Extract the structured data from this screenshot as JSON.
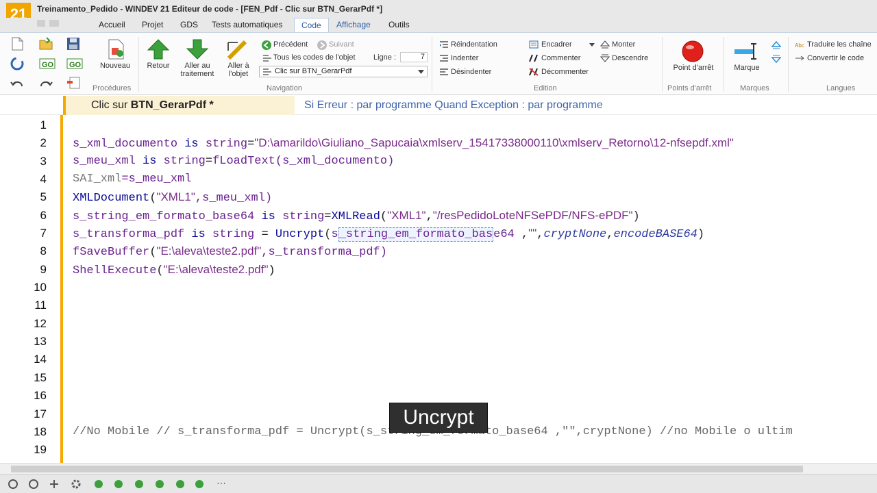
{
  "window": {
    "logo_text": "21",
    "title": "Treinamento_Pedido - WINDEV 21  Editeur de code - [FEN_Pdf - Clic sur BTN_GerarPdf *]"
  },
  "menu_tabs": [
    {
      "label": "Accueil"
    },
    {
      "label": "Projet"
    },
    {
      "label": "GDS"
    },
    {
      "label": "Tests automatiques"
    },
    {
      "label": "Code"
    },
    {
      "label": "Affichage"
    },
    {
      "label": "Outils"
    }
  ],
  "ribbon": {
    "procedures": {
      "nouveau_label": "Nouveau",
      "group_label": "Procédures"
    },
    "navigation": {
      "retour_label": "Retour",
      "aller_traitement_label_1": "Aller au",
      "aller_traitement_label_2": "traitement",
      "aller_objet_label_1": "Aller à",
      "aller_objet_label_2": "l'objet",
      "precedent_label": "Précédent",
      "suivant_label": "Suivant",
      "tous_codes_label": "Tous les codes de l'objet",
      "ligne_label": "Ligne :",
      "ligne_value": "7",
      "combo_value": "Clic sur BTN_GerarPdf",
      "group_label": "Navigation"
    },
    "edition": {
      "reindentation_label": "Réindentation",
      "indenter_label": "Indenter",
      "desindenter_label": "Désindenter",
      "encadrer_label": "Encadrer",
      "commenter_label": "Commenter",
      "decommenter_label": "Décommenter",
      "monter_label": "Monter",
      "descendre_label": "Descendre",
      "group_label": "Edition"
    },
    "points_arret": {
      "point_arret_label": "Point d'arrêt",
      "group_label": "Points d'arrêt"
    },
    "marques": {
      "marque_label": "Marque",
      "group_label": "Marques"
    },
    "langues": {
      "traduire_label": "Traduire les chaîne",
      "convertir_label": "Convertir le code",
      "group_label": "Langues"
    }
  },
  "document": {
    "tab_prefix": "Clic sur ",
    "tab_name": "BTN_GerarPdf *",
    "error_info": "Si Erreur : par programme   Quand Exception : par programme"
  },
  "editor": {
    "line_numbers": [
      "1",
      "2",
      "3",
      "4",
      "5",
      "6",
      "7",
      "8",
      "9",
      "10",
      "11",
      "12",
      "13",
      "14",
      "15",
      "16",
      "17",
      "18",
      "19"
    ],
    "lines": {
      "l2": {
        "var": "s_xml_documento",
        "kw1": " is ",
        "type": "string",
        "op": "=",
        "str": "\"D:\\amarildo\\Giuliano_Sapucaia\\xmlserv_15417338000110\\xmlserv_Retorno\\12-nfsepdf.xml\""
      },
      "l3": {
        "var": "s_meu_xml",
        "kw1": " is ",
        "type": "string",
        "op": "=",
        "fn": "fLoadText",
        "args": "(s_xml_documento)"
      },
      "l4": {
        "gray": "SAI_xml",
        "rest": "=s_meu_xml"
      },
      "l5": {
        "fn": "XMLDocument",
        "open": "(",
        "str": "\"XML1\"",
        "rest": ",s_meu_xml)"
      },
      "l6": {
        "var": "s_string_em_formato_base64",
        "kw1": " is ",
        "type": "string",
        "op": "=",
        "fn": "XMLRead",
        "open": "(",
        "str1": "\"XML1\"",
        "comma": ",",
        "str2": "\"/resPedidoLoteNFSePDF/NFS-ePDF\"",
        "close": ")"
      },
      "l7": {
        "var": "s_transforma_pdf",
        "kw1": " is ",
        "type": "string",
        "op": " = ",
        "fn": "Uncrypt",
        "open": "(",
        "sel_pre": "s",
        "sel": "_string_em_formato_bas",
        "sel_post": "e64",
        "space": " ,",
        "str": "\"\"",
        "comma": ",",
        "c1": "cryptNone",
        "comma2": ",",
        "c2": "encodeBASE64",
        "close": ")"
      },
      "l8": {
        "fn": "fSaveBuffer",
        "open": "(",
        "str": "\"E:\\aleva\\teste2.pdf\"",
        "rest": ",s_transforma_pdf)"
      },
      "l9": {
        "fn": "ShellExecute",
        "open": "(",
        "str": "\"E:\\aleva\\teste2.pdf\"",
        "close": ")"
      },
      "l18": {
        "comment": "//No Mobile // s_transforma_pdf = Uncrypt(s_string_em_formato_base64 ,\"\",cryptNone) //no Mobile o ultim"
      }
    },
    "tooltip": "Uncrypt"
  },
  "colors": {
    "accent_orange": "#f5a800",
    "keyword_blue": "#0a0a96",
    "identifier_purple": "#6a2190",
    "tab_active_blue": "#2a5ea8"
  }
}
